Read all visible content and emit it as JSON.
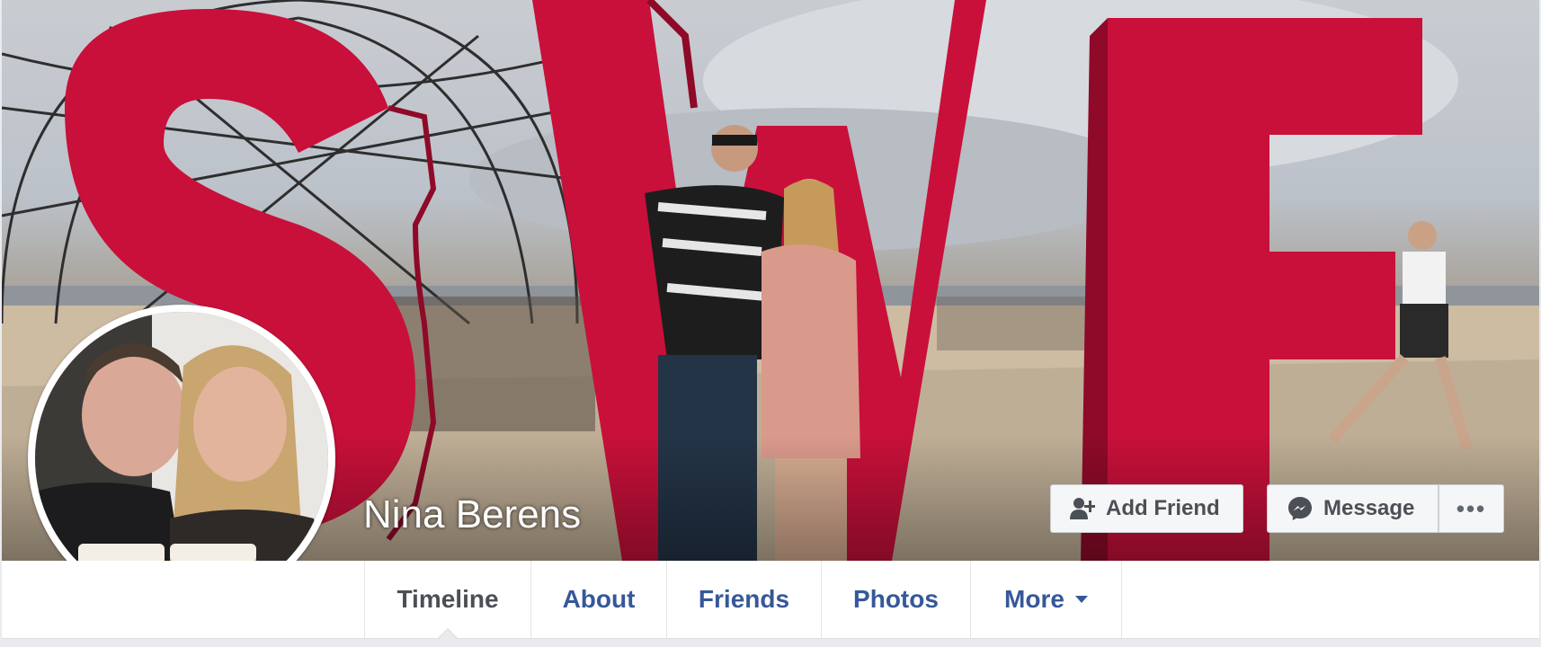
{
  "profile": {
    "name": "Nina Berens"
  },
  "actions": {
    "add_friend": "Add Friend",
    "message": "Message",
    "more": "•••"
  },
  "tabs": [
    {
      "label": "Timeline",
      "active": true
    },
    {
      "label": "About",
      "active": false
    },
    {
      "label": "Friends",
      "active": false
    },
    {
      "label": "Photos",
      "active": false
    },
    {
      "label": "More",
      "active": false,
      "dropdown": true
    }
  ],
  "colors": {
    "link_blue": "#365899",
    "active_tab_text": "#4b4f56",
    "letter_red": "#c8103a",
    "page_background": "#e9ebee"
  },
  "icons": {
    "add_friend": "add-friend-icon",
    "message": "messenger-icon",
    "more_dropdown": "caret-down-icon"
  }
}
